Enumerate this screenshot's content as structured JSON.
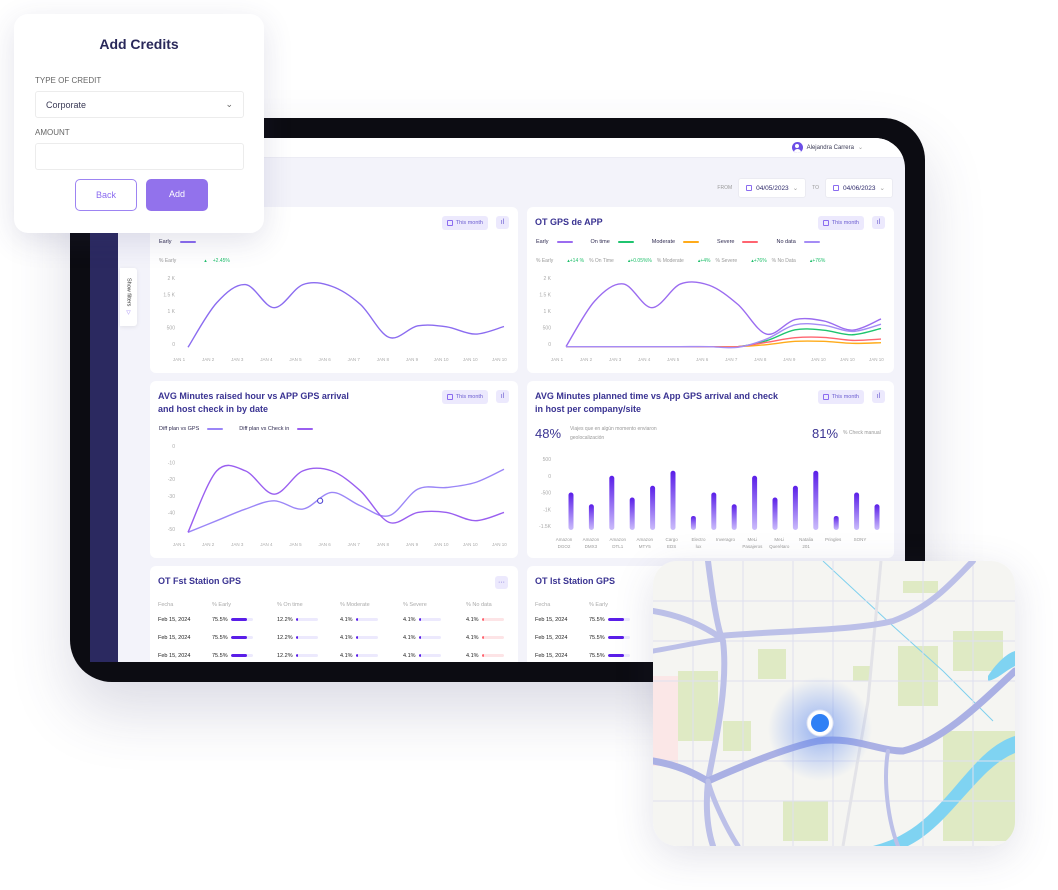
{
  "colors": {
    "accent": "#8b6cf0",
    "primary": "#5a1ee8",
    "positive": "#1fbf6b",
    "sidebar": "#2b2960"
  },
  "header": {
    "user_name": "Alejandra Carrera",
    "avatar_icon": "user-circle-icon",
    "from_label": "FROM",
    "from_date": "04/05/2023",
    "to_label": "TO",
    "to_date": "04/06/2023"
  },
  "filters": {
    "label": "Show filters",
    "icon": "filter-icon"
  },
  "common": {
    "this_month": "This month",
    "x_labels": [
      "JAN 1",
      "JAN 2",
      "JAN 3",
      "JAN 4",
      "JAN 5",
      "JAN 6",
      "JAN 7",
      "JAN 8",
      "JAN 9",
      "JAN 10",
      "JAN 10",
      "JAN 10"
    ]
  },
  "card1": {
    "legend": "Early",
    "pct_label": "% Early",
    "pct_value": "+2.45%"
  },
  "card2": {
    "title": "OT GPS de APP",
    "legend": [
      "Early",
      "On time",
      "Moderate",
      "Severe",
      "No data"
    ],
    "pct": [
      {
        "label": "% Early",
        "value": "+14 %"
      },
      {
        "label": "% On Time",
        "value": "+0.05%%"
      },
      {
        "label": "% Moderate",
        "value": "+4%"
      },
      {
        "label": "% Severe",
        "value": "+76%"
      },
      {
        "label": "% No Data",
        "value": "+76%"
      }
    ]
  },
  "card3": {
    "title": "AVG Minutes raised hour vs APP GPS arrival and host check in by date",
    "legend": [
      "Diff plan vs GPS",
      "Diff plan vs Check in"
    ]
  },
  "card4": {
    "title": "AVG Minutes planned time vs App GPS arrival and check in host per company/site",
    "stat1": "48%",
    "stat1_label": "Viajes que en algún momento enviaron geolocalización",
    "stat2": "81%",
    "stat2_label": "% Check manual"
  },
  "card5": {
    "title": "OT Fst Station GPS",
    "more_icon": "more-horizontal-icon",
    "columns": [
      "Fecha",
      "% Early",
      "% On time",
      "% Moderate",
      "% Severe",
      "% No data"
    ],
    "rows": [
      [
        "Feb 15, 2024",
        "75.5%",
        "12.2%",
        "4.1%",
        "4.1%",
        "4.1%"
      ],
      [
        "Feb 15, 2024",
        "75.5%",
        "12.2%",
        "4.1%",
        "4.1%",
        "4.1%"
      ],
      [
        "Feb 15, 2024",
        "75.5%",
        "12.2%",
        "4.1%",
        "4.1%",
        "4.1%"
      ]
    ],
    "fills": [
      75.5,
      12.2,
      4.1,
      4.1,
      4.1
    ]
  },
  "card6": {
    "title": "OT lst Station GPS",
    "columns": [
      "Fecha",
      "% Early"
    ],
    "rows": [
      [
        "Feb 15, 2024",
        "75.5%"
      ],
      [
        "Feb 15, 2024",
        "75.5%"
      ],
      [
        "Feb 15, 2024",
        "75.5%"
      ]
    ]
  },
  "credits": {
    "title": "Add Credits",
    "type_label": "TYPE OF CREDIT",
    "type_value": "Corporate",
    "amount_label": "AMOUNT",
    "amount_value": "",
    "back": "Back",
    "add": "Add"
  },
  "chart_data": [
    {
      "type": "line",
      "categories": [
        "JAN 1",
        "JAN 2",
        "JAN 3",
        "JAN 4",
        "JAN 5",
        "JAN 6",
        "JAN 7",
        "JAN 8",
        "JAN 9",
        "JAN 10",
        "JAN 10",
        "JAN 10"
      ],
      "yticks": [
        "2 K",
        "1.5 K",
        "1 K",
        "500",
        "0"
      ],
      "ylim": [
        0,
        2000
      ],
      "series": [
        {
          "name": "Early",
          "color": "#8b6cf0",
          "values": [
            -100,
            1250,
            1800,
            1100,
            1800,
            1750,
            1200,
            200,
            550,
            520,
            300,
            530
          ]
        }
      ]
    },
    {
      "type": "line",
      "categories": [
        "JAN 1",
        "JAN 2",
        "JAN 3",
        "JAN 4",
        "JAN 5",
        "JAN 6",
        "JAN 7",
        "JAN 8",
        "JAN 9",
        "JAN 10",
        "JAN 10",
        "JAN 10"
      ],
      "yticks": [
        "2 K",
        "1.5 K",
        "1 K",
        "500",
        "0"
      ],
      "ylim": [
        0,
        2000
      ],
      "series": [
        {
          "name": "Early",
          "color": "#9b6cf0",
          "values": [
            -80,
            1300,
            1820,
            1100,
            1820,
            1780,
            1200,
            300,
            740,
            700,
            420,
            760
          ]
        },
        {
          "name": "On time",
          "color": "#1fc46f",
          "values": [
            -80,
            -80,
            -80,
            -80,
            -80,
            -80,
            -80,
            100,
            430,
            420,
            280,
            470
          ]
        },
        {
          "name": "Moderate",
          "color": "#ffab1a",
          "values": [
            -80,
            -80,
            -80,
            -80,
            -80,
            -80,
            -80,
            -20,
            80,
            80,
            20,
            40
          ]
        },
        {
          "name": "Severe",
          "color": "#ff6470",
          "values": [
            -80,
            -80,
            -80,
            -80,
            -80,
            -80,
            -80,
            50,
            190,
            200,
            110,
            150
          ]
        },
        {
          "name": "No data",
          "color": "#a58cf5",
          "values": [
            -80,
            -80,
            -80,
            -80,
            -80,
            -80,
            -100,
            150,
            580,
            570,
            380,
            600
          ]
        }
      ]
    },
    {
      "type": "line",
      "categories": [
        "JAN 1",
        "JAN 2",
        "JAN 3",
        "JAN 4",
        "JAN 5",
        "JAN 6",
        "JAN 7",
        "JAN 8",
        "JAN 9",
        "JAN 10",
        "JAN 10",
        "JAN 10"
      ],
      "yticks": [
        "0",
        "-10",
        "-20",
        "-30",
        "-40",
        "-50"
      ],
      "ylim": [
        -50,
        0
      ],
      "series": [
        {
          "name": "Diff plan vs GPS",
          "color": "#9b86f7",
          "values": [
            -52,
            -45,
            -38,
            -33,
            -38,
            -28,
            -36,
            -42,
            -26,
            -25,
            -22,
            -14
          ]
        },
        {
          "name": "Diff plan vs Check in",
          "color": "#9a5ff0",
          "values": [
            -52,
            -15,
            -15,
            -29,
            -15,
            -15,
            -27,
            -46,
            -40,
            -40,
            -45,
            -40
          ]
        }
      ]
    },
    {
      "type": "bar",
      "categories": [
        "Amazon DGO2",
        "Amazon DMX3",
        "Amazon DTL1",
        "Amazon MTY5",
        "Cargo EDS",
        "Electro lux",
        "Inveragro",
        "MeLi Pasajeros",
        "MeLi Querétaro",
        "Natalia 201",
        "Pringles",
        "SONY"
      ],
      "yticks": [
        "500",
        "0",
        "-500",
        "-1K",
        "-1.5K"
      ],
      "ylim": [
        -1500,
        500
      ],
      "values": [
        -500,
        -850,
        0,
        -650,
        -300,
        150,
        -1200,
        -500,
        -850,
        0,
        -650,
        -300,
        150,
        -1200,
        -500,
        -850
      ]
    }
  ]
}
